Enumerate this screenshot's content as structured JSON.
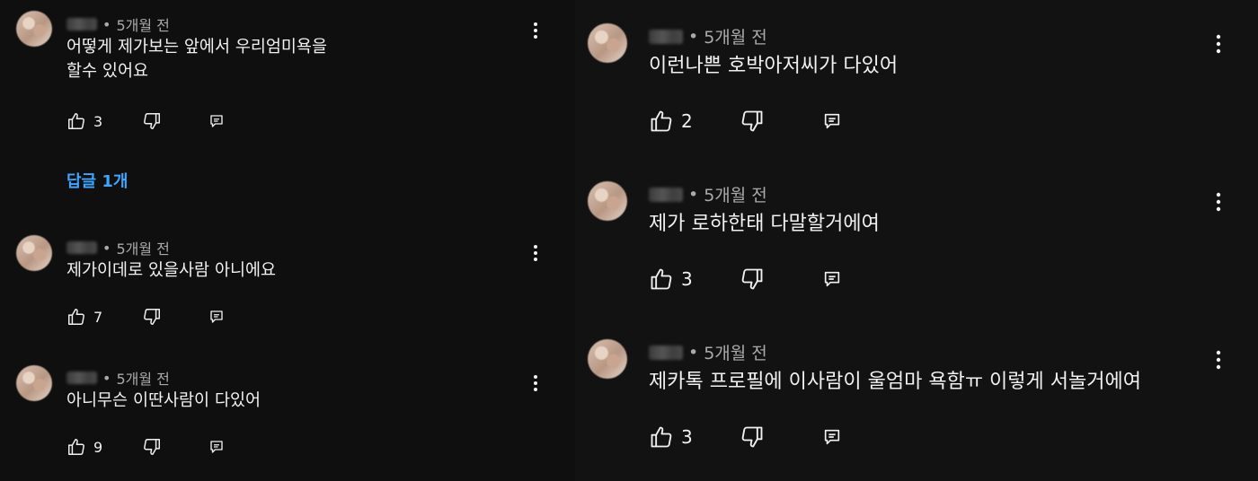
{
  "left_comments": [
    {
      "time": "5개월 전",
      "lines": [
        "어떻게 제가보는 앞에서 우리엄미욕을",
        "할수 있어요"
      ],
      "likes": "3",
      "replies_label": "답글 1개"
    },
    {
      "time": "5개월 전",
      "lines": [
        "제가이데로 있을사람 아니에요"
      ],
      "likes": "7"
    },
    {
      "time": "5개월 전",
      "lines": [
        "아니무슨 이딴사람이 다있어"
      ],
      "likes": "9"
    }
  ],
  "right_comments": [
    {
      "time": "5개월 전",
      "lines": [
        "이런나쁜 호박아저씨가 다있어"
      ],
      "likes": "2"
    },
    {
      "time": "5개월 전",
      "lines": [
        "제가 로하한태 다말할거에여"
      ],
      "likes": "3"
    },
    {
      "time": "5개월 전",
      "lines": [
        "제카톡 프로필에 이사람이 울엄마 욕함ㅠ 이렇게 서놀거에여"
      ],
      "likes": "3"
    }
  ],
  "icons": {
    "like": "thumbs-up-icon",
    "dislike": "thumbs-down-icon",
    "reply": "reply-icon",
    "more": "more-vert-icon"
  },
  "colors": {
    "background": "#0f0f0f",
    "text": "#f1f1f1",
    "meta": "#aaaaaa",
    "link": "#3ea6ff"
  }
}
